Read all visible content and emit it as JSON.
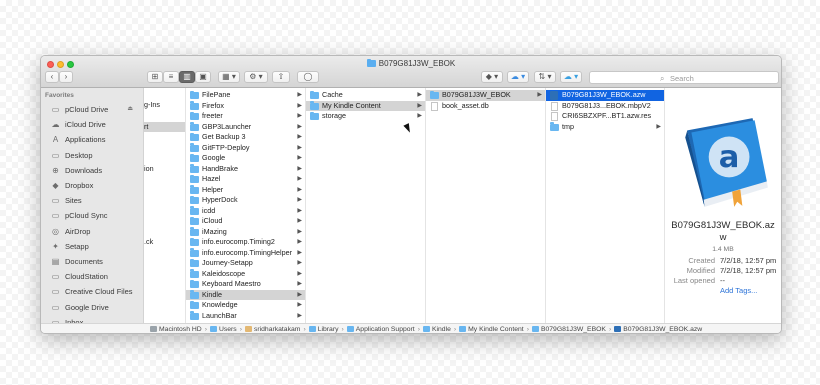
{
  "window": {
    "title": "B079G81J3W_EBOK"
  },
  "toolbar": {
    "back": "‹",
    "forward": "›",
    "search_placeholder": "Search"
  },
  "sidebar": {
    "heading": "Favorites",
    "items": [
      {
        "label": "pCloud Drive",
        "icon": "cloud-drive-icon",
        "glyph": "▭",
        "eject": "⏏"
      },
      {
        "label": "iCloud Drive",
        "icon": "cloud-icon",
        "glyph": "☁"
      },
      {
        "label": "Applications",
        "icon": "applications-icon",
        "glyph": "A"
      },
      {
        "label": "Desktop",
        "icon": "desktop-icon",
        "glyph": "▭"
      },
      {
        "label": "Downloads",
        "icon": "downloads-icon",
        "glyph": "⊕"
      },
      {
        "label": "Dropbox",
        "icon": "dropbox-icon",
        "glyph": "◆"
      },
      {
        "label": "Sites",
        "icon": "folder-icon",
        "glyph": "▭"
      },
      {
        "label": "pCloud Sync",
        "icon": "folder-icon",
        "glyph": "▭"
      },
      {
        "label": "AirDrop",
        "icon": "airdrop-icon",
        "glyph": "◎"
      },
      {
        "label": "Setapp",
        "icon": "setapp-icon",
        "glyph": "✦"
      },
      {
        "label": "Documents",
        "icon": "documents-icon",
        "glyph": "▤"
      },
      {
        "label": "CloudStation",
        "icon": "folder-icon",
        "glyph": "▭"
      },
      {
        "label": "Creative Cloud Files",
        "icon": "folder-icon",
        "glyph": "▭"
      },
      {
        "label": "Google Drive",
        "icon": "folder-icon",
        "glyph": "▭"
      },
      {
        "label": "Inbox",
        "icon": "inbox-icon",
        "glyph": "▭"
      }
    ]
  },
  "column0": {
    "fragments": [
      "g-Ins",
      "rt",
      "ion",
      ".ck"
    ]
  },
  "column1": {
    "items": [
      "FilePane",
      "Firefox",
      "freeter",
      "GBP3Launcher",
      "Get Backup 3",
      "GitFTP-Deploy",
      "Google",
      "HandBrake",
      "Hazel",
      "Helper",
      "HyperDock",
      "icdd",
      "iCloud",
      "iMazing",
      "info.eurocomp.Timing2",
      "info.eurocomp.TimingHelper",
      "Journey-Setapp",
      "Kaleidoscope",
      "Keyboard Maestro",
      "Kindle",
      "Knowledge",
      "LaunchBar"
    ],
    "selected": "Kindle"
  },
  "column2": {
    "items": [
      "Cache",
      "My Kindle Content",
      "storage"
    ],
    "selected": "My Kindle Content"
  },
  "column3": {
    "items": [
      "B079G81J3W_EBOK",
      "book_asset.db"
    ],
    "selected": "B079G81J3W_EBOK"
  },
  "column4": {
    "items": [
      "B079G81J3W_EBOK.azw",
      "B079G81J3...EBOK.mbpV2",
      "CRI6SBZXPF...BT1.azw.res",
      "tmp"
    ],
    "selected": "B079G81J3W_EBOK.azw"
  },
  "preview": {
    "name_line1": "B079G81J3W_EBOK.az",
    "name_line2": "w",
    "size": "1.4 MB",
    "created_label": "Created",
    "created": "7/2/18, 12:57 pm",
    "modified_label": "Modified",
    "modified": "7/2/18, 12:57 pm",
    "last_opened_label": "Last opened",
    "last_opened": "--",
    "add_tags": "Add Tags..."
  },
  "pathbar": [
    "Macintosh HD",
    "Users",
    "sridharkatakam",
    "Library",
    "Application Support",
    "Kindle",
    "My Kindle Content",
    "B079G81J3W_EBOK",
    "B079G81J3W_EBOK.azw"
  ],
  "colors": {
    "selection_blue": "#1164e1",
    "folder_blue": "#69b7f1",
    "selection_gray": "#d4d4d4"
  }
}
